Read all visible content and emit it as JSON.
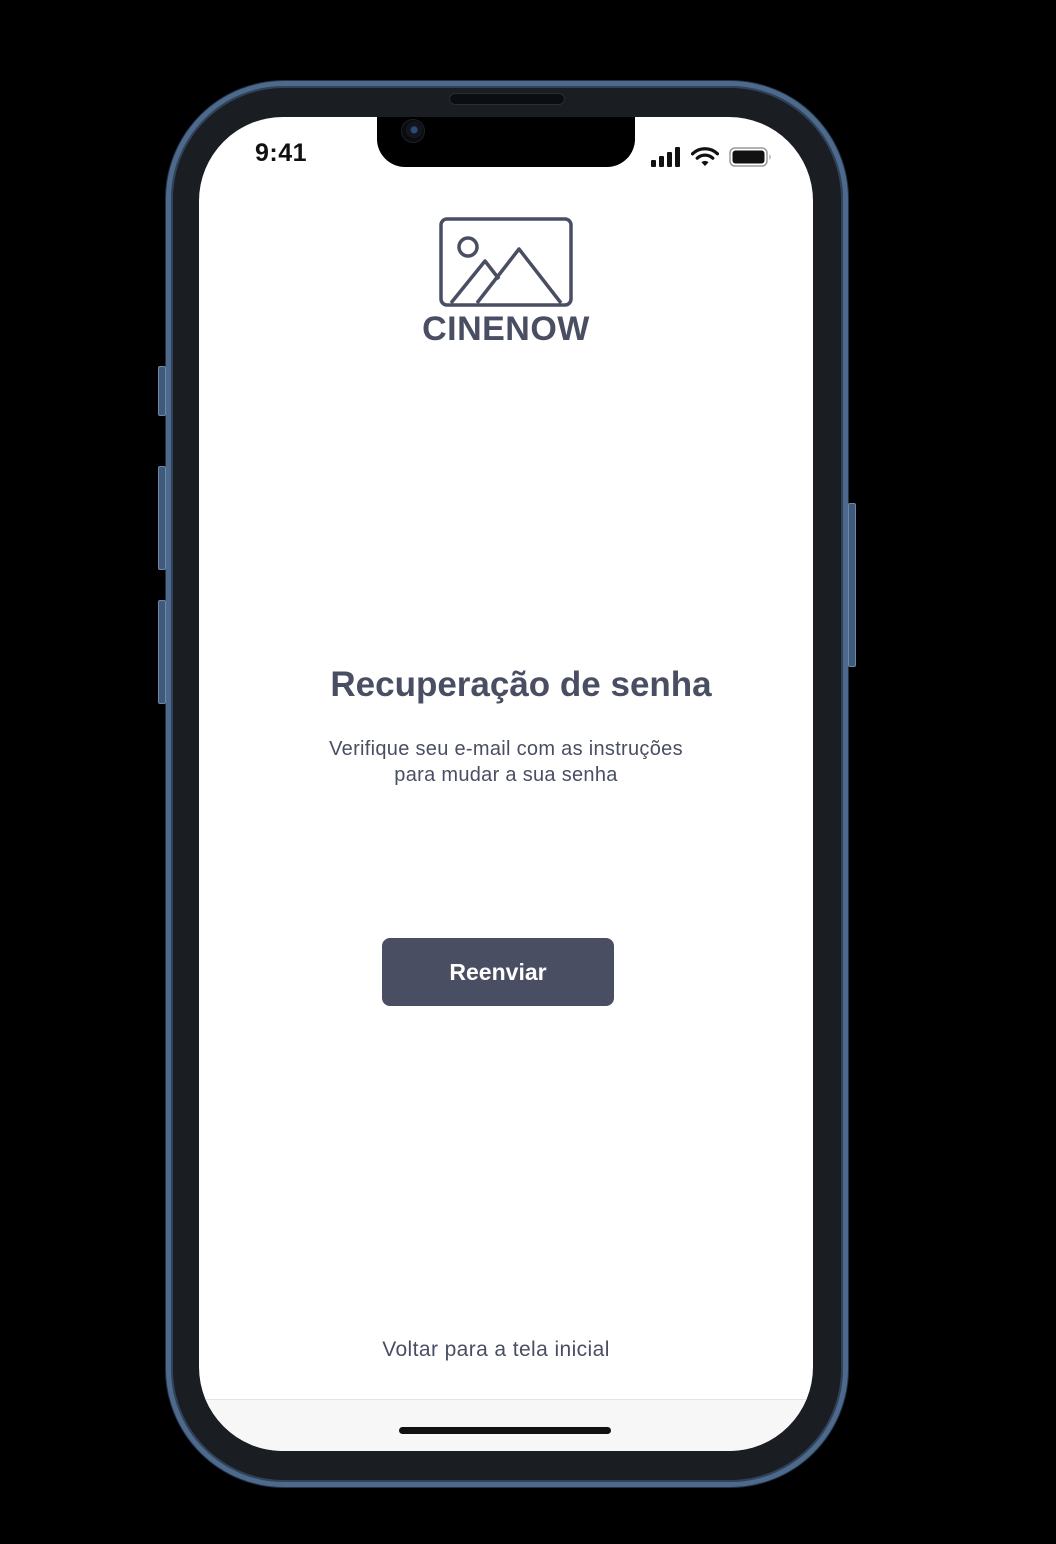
{
  "status_bar": {
    "time": "9:41",
    "icons": [
      "signal-icon",
      "wifi-icon",
      "battery-icon"
    ]
  },
  "logo": {
    "icon": "image-placeholder-icon",
    "text": "CINENOW"
  },
  "recovery": {
    "title": "Recuperação de senha",
    "message_line1": "Verifique seu e-mail com as instruções",
    "message_line2": "para mudar a sua senha",
    "resend_label": "Reenviar"
  },
  "footer": {
    "back_link": "Voltar para a tela inicial"
  },
  "colors": {
    "primary": "#4a4e63",
    "background": "#ffffff",
    "phone_frame": "#4d6a8c",
    "page_background": "#000000"
  }
}
